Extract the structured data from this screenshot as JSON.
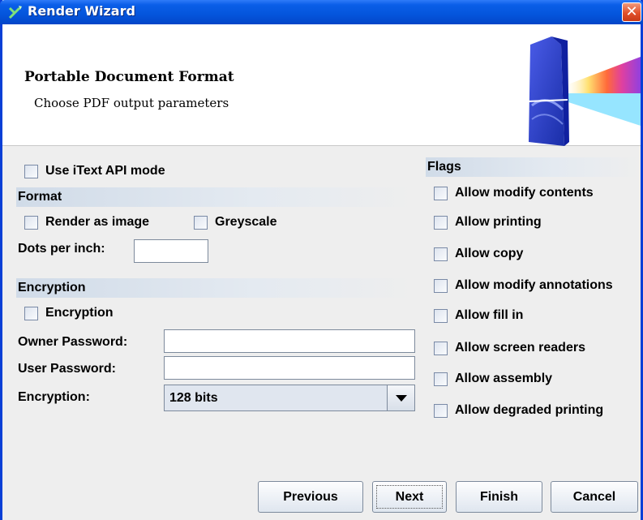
{
  "window": {
    "title": "Render Wizard"
  },
  "header": {
    "title": "Portable Document Format",
    "subtitle": "Choose PDF output parameters"
  },
  "left": {
    "itext_mode": {
      "label": "Use iText API mode",
      "checked": false
    },
    "format": {
      "section": "Format",
      "render_as_image": {
        "label": "Render as image",
        "checked": false
      },
      "greyscale": {
        "label": "Greyscale",
        "checked": false
      },
      "dpi_label": "Dots per inch:",
      "dpi_value": ""
    },
    "encryption": {
      "section": "Encryption",
      "enable": {
        "label": "Encryption",
        "checked": false
      },
      "owner_label": "Owner Password:",
      "owner_value": "",
      "user_label": "User Password:",
      "user_value": "",
      "strength_label": "Encryption:",
      "strength_value": "128 bits"
    }
  },
  "flags": {
    "section": "Flags",
    "items": [
      {
        "label": "Allow modify contents",
        "checked": false
      },
      {
        "label": "Allow printing",
        "checked": false
      },
      {
        "label": "Allow copy",
        "checked": false
      },
      {
        "label": "Allow modify annotations",
        "checked": false
      },
      {
        "label": "Allow fill in",
        "checked": false
      },
      {
        "label": "Allow screen readers",
        "checked": false
      },
      {
        "label": "Allow assembly",
        "checked": false
      },
      {
        "label": "Allow degraded printing",
        "checked": false
      }
    ]
  },
  "buttons": {
    "previous": "Previous",
    "next": "Next",
    "finish": "Finish",
    "cancel": "Cancel"
  },
  "icons": {
    "app": "wizard-icon",
    "close": "close-icon",
    "graphic": "prism-graphic"
  },
  "colors": {
    "titlebar": "#0455dc",
    "close": "#e2502a",
    "section": "#d0dbe8"
  }
}
